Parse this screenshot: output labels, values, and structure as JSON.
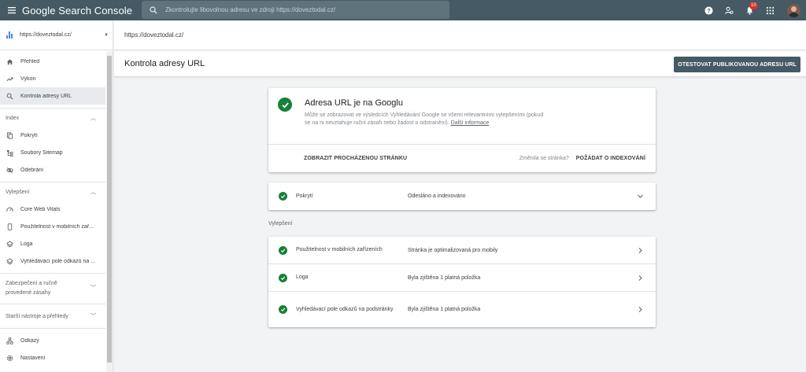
{
  "app": {
    "title": "Google Search Console",
    "search_placeholder": "Zkontrolujte libovolnou adresu ve zdroji https://doveztodal.cz/",
    "notification_count": "10"
  },
  "sidebar": {
    "property": "https://doveztodal.cz/",
    "items_top": [
      {
        "label": "Přehled"
      },
      {
        "label": "Výkon"
      },
      {
        "label": "Kontrola adresy URL",
        "active": true
      }
    ],
    "index_section": {
      "title": "Index",
      "items": [
        {
          "label": "Pokrytí"
        },
        {
          "label": "Soubory Sitemap"
        },
        {
          "label": "Odebrání"
        }
      ]
    },
    "enhancements_section": {
      "title": "Vylepšení",
      "items": [
        {
          "label": "Core Web Vitals"
        },
        {
          "label": "Použitelnost v mobilních zař..."
        },
        {
          "label": "Loga"
        },
        {
          "label": "Vyhledávací pole odkazů na ..."
        }
      ]
    },
    "security_section": {
      "title": "Zabezpečení a ručně provedené zásahy"
    },
    "legacy_section": {
      "title": "Starší nástroje a přehledy"
    },
    "items_bottom": [
      {
        "label": "Odkazy"
      },
      {
        "label": "Nastavení"
      }
    ]
  },
  "header": {
    "url": "https://doveztodal.cz/",
    "page_title": "Kontrola adresy URL",
    "test_button": "OTESTOVAT PUBLIKOVANOU ADRESU URL"
  },
  "status": {
    "title": "Adresa URL je na Googlu",
    "description": "Může se zobrazovat ve výsledcích Vyhledávání Google se všemi relevantními vylepšeními (pokud se na ni nevztahuje ruční zásah nebo žádost o odstranění).",
    "more_link": "Další informace",
    "crawled_button": "ZOBRAZIT PROCHÁZENOU STRÁNKU",
    "changed_question": "Změnila se stránka?",
    "request_button": "POŽÁDAT O INDEXOVÁNÍ"
  },
  "coverage": {
    "name": "Pokrytí",
    "value": "Odesláno a indexováno"
  },
  "enhancements": {
    "label": "Vylepšení",
    "rows": [
      {
        "name": "Použitelnost v mobilních zařízeních",
        "value": "Stránka je optimalizovaná pro mobily"
      },
      {
        "name": "Loga",
        "value": "Byla zjištěna 1 platná položka"
      },
      {
        "name": "Vyhledávací pole odkazů na podstránky",
        "value": "Byla zjištěna 1 platná položka"
      }
    ]
  },
  "colors": {
    "topbar": "#455a64",
    "success": "#188038",
    "accent": "#4285f4",
    "badge": "#d93025"
  }
}
